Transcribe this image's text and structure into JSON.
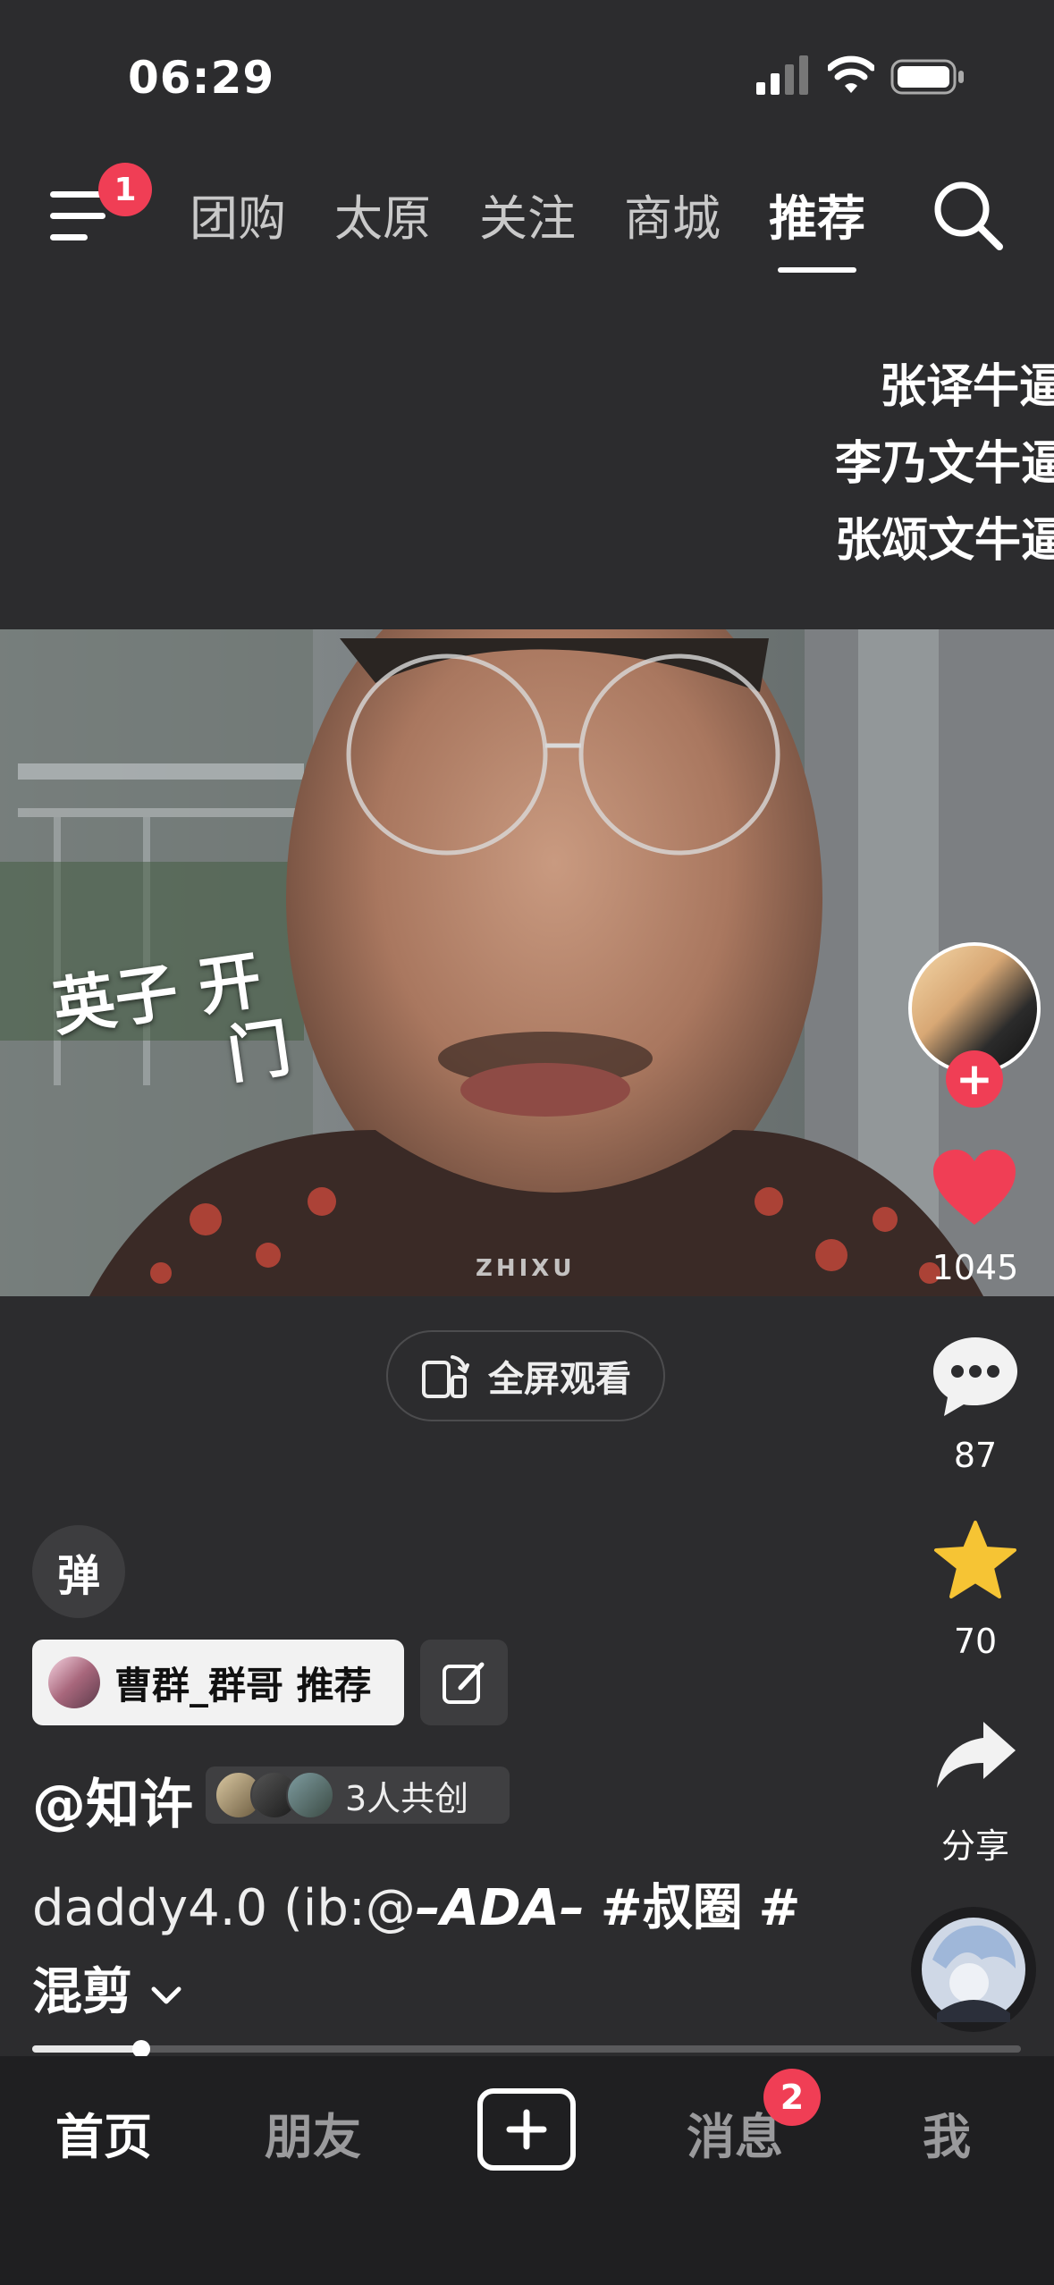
{
  "status_bar": {
    "time": "06:29"
  },
  "top_nav": {
    "menu_badge": "1",
    "tabs": [
      {
        "label": "团购"
      },
      {
        "label": "太原"
      },
      {
        "label": "关注"
      },
      {
        "label": "商城"
      },
      {
        "label": "推荐",
        "active": true
      }
    ]
  },
  "danmaku": [
    "张译牛逼",
    "李乃文牛逼",
    "张颂文牛逼"
  ],
  "video": {
    "overlay_text": [
      "英子 开",
      "门"
    ],
    "watermark": "ZHIXU"
  },
  "right_rail": {
    "like_count": "1045",
    "comment_count": "87",
    "favorite_count": "70",
    "share_label": "分享"
  },
  "fullscreen_label": "全屏观看",
  "danmaku_toggle": "弹",
  "recommender": {
    "label": "曹群_群哥 推荐"
  },
  "author": {
    "name": "@知许",
    "cocreate_label": "3人共创"
  },
  "description": {
    "prefix": "daddy4.0 (ib:@",
    "mention": "–ADA–",
    "tag1": "#叔圈",
    "tag2": "#",
    "line2": "混剪"
  },
  "progress": {
    "fraction": 0.11
  },
  "bottom_nav": {
    "home": "首页",
    "friends": "朋友",
    "messages": "消息",
    "messages_badge": "2",
    "me": "我"
  },
  "colors": {
    "accent": "#f03e55",
    "background": "#2c2c2e",
    "favorite": "#f6c434"
  }
}
